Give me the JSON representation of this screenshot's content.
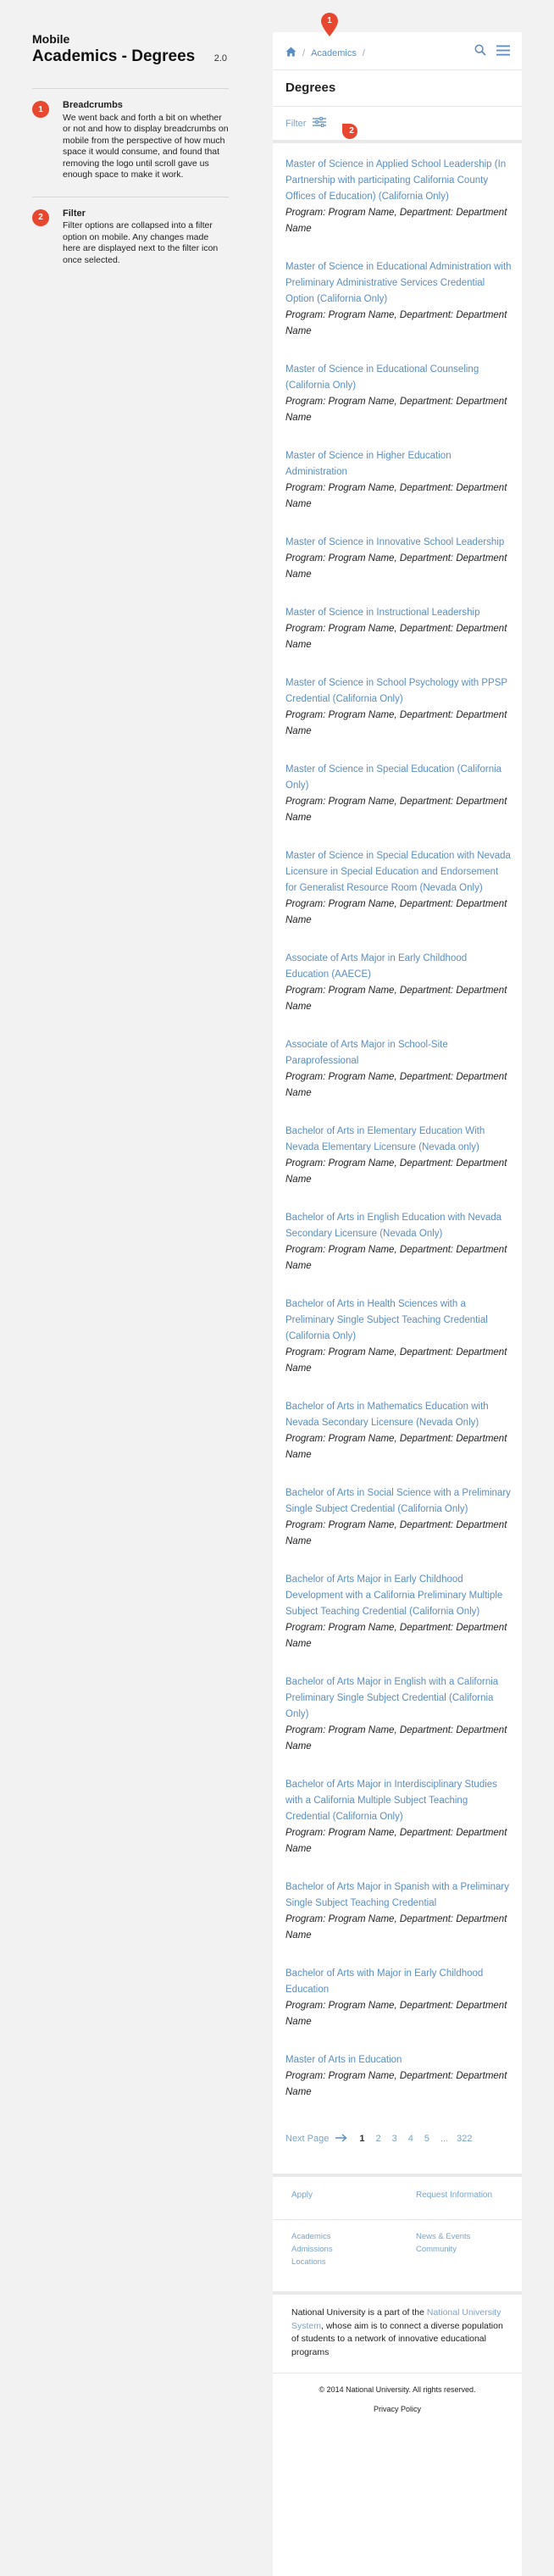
{
  "doc": {
    "kicker": "Mobile",
    "title": "Academics - Degrees",
    "version": "2.0"
  },
  "notes": [
    {
      "number": "1",
      "title": "Breadcrumbs",
      "body": "We went back and forth a bit on whether or not and how to display breadcrumbs on mobile from the perspective of how much space it would consume, and found that removing the logo until scroll gave us enough space to make it work."
    },
    {
      "number": "2",
      "title": "Filter",
      "body": "Filter options are collapsed into a filter option on mobile. Any changes made here are displayed next to the filter icon once selected."
    }
  ],
  "header": {
    "icons": {
      "home": "home-icon",
      "search": "search-icon",
      "menu": "hamburger-menu-icon"
    },
    "breadcrumb": [
      "Academics"
    ],
    "title": "Degrees"
  },
  "filter": {
    "label": "Filter",
    "icon": "sliders-icon"
  },
  "meta_text": "Program: Program Name, Department: Department Name",
  "programs": [
    "Master of Science in Applied School Leadership (In Partnership with participating California County Offices of Education) (California Only)",
    "Master of Science in Educational Administration with Preliminary Administrative Services Credential Option (California Only)",
    "Master of Science in Educational Counseling (California Only)",
    "Master of Science in Higher Education Administration",
    "Master of Science in Innovative School Leadership",
    "Master of Science in Instructional Leadership",
    "Master of Science in School Psychology with PPSP Credential (California Only)",
    "Master of Science in Special Education (California Only)",
    "Master of Science in Special Education with Nevada Licensure in Special Education and Endorsement for Generalist Resource Room (Nevada Only)",
    "Associate of Arts Major in Early Childhood Education (AAECE)",
    "Associate of Arts Major in School-Site Paraprofessional",
    "Bachelor of Arts in Elementary Education With Nevada Elementary Licensure (Nevada only)",
    "Bachelor of Arts in English Education with Nevada Secondary Licensure (Nevada Only)",
    "Bachelor of Arts in Health Sciences with a Preliminary Single Subject Teaching Credential (California Only)",
    "Bachelor of Arts in Mathematics Education with Nevada Secondary Licensure (Nevada Only)",
    "Bachelor of Arts in Social Science with a Preliminary Single Subject Credential (California Only)",
    "Bachelor of Arts Major in Early Childhood Development with a California Preliminary Multiple Subject Teaching Credential (California Only)",
    "Bachelor of Arts Major in English with a California Preliminary Single Subject Credential (California Only)",
    "Bachelor of Arts Major in Interdisciplinary Studies with a California Multiple Subject Teaching Credential (California Only)",
    "Bachelor of Arts Major in Spanish with a Preliminary Single Subject Teaching Credential",
    "Bachelor of Arts with Major in Early Childhood Education",
    "Master of Arts in Education"
  ],
  "pagination": {
    "next_label": "Next Page",
    "arrow_icon": "arrow-right-icon",
    "pages": [
      "1",
      "2",
      "3",
      "4",
      "5"
    ],
    "current": "1",
    "ellipsis": "...",
    "last": "322"
  },
  "footer": {
    "primary_links": [
      "Apply",
      "Request Information"
    ],
    "secondary_left": [
      "Academics",
      "Admissions",
      "Locations"
    ],
    "secondary_right": [
      "News & Events",
      "Community"
    ],
    "about_prefix": "National University is a part of the",
    "about_link": "National University System",
    "about_suffix": ", whose aim is to connect a diverse population of students to a network of innovative educational programs",
    "copyright": "© 2014 National University. All rights reserved.",
    "privacy": "Privacy Policy"
  },
  "colors": {
    "accent": "#5a8dc0",
    "badge": "#e8472f",
    "link_light": "#7aa3c9"
  }
}
